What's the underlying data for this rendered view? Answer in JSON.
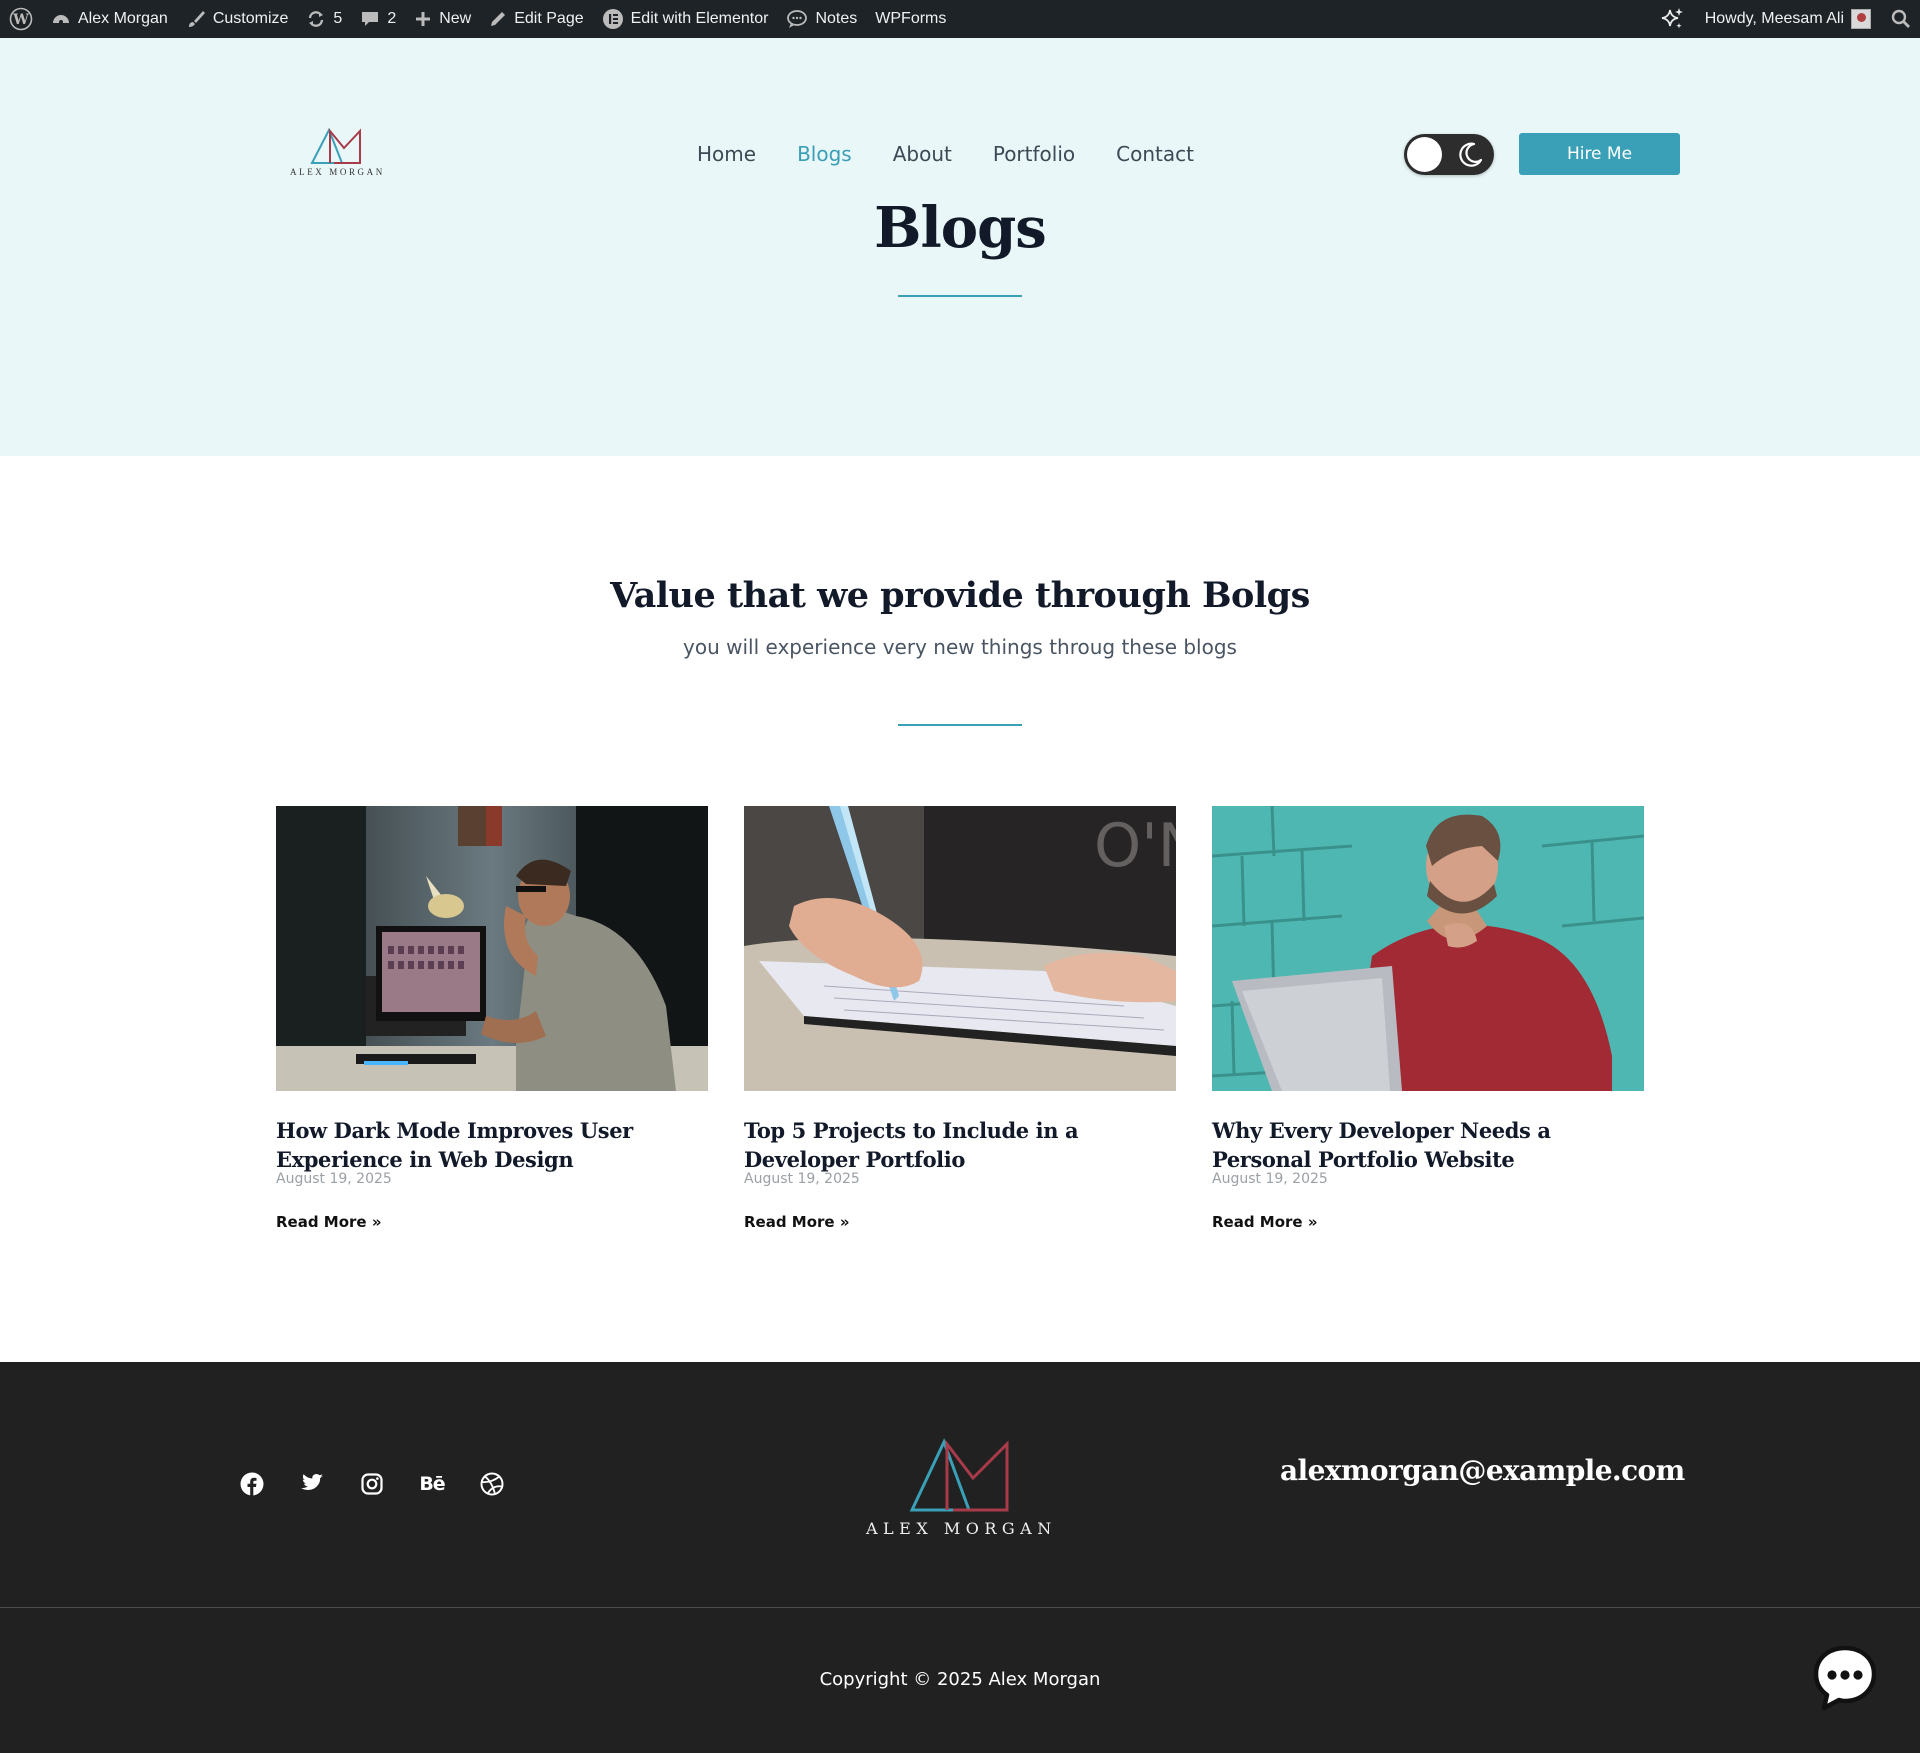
{
  "admin_bar": {
    "site_name": "Alex Morgan",
    "customize": "Customize",
    "updates_count": "5",
    "comments_count": "2",
    "new": "New",
    "edit_page": "Edit Page",
    "edit_elementor": "Edit with Elementor",
    "notes": "Notes",
    "wpforms": "WPForms",
    "howdy": "Howdy, Meesam Ali"
  },
  "header": {
    "logo_text": "ALEX MORGAN",
    "nav": [
      {
        "label": "Home"
      },
      {
        "label": "Blogs"
      },
      {
        "label": "About"
      },
      {
        "label": "Portfolio"
      },
      {
        "label": "Contact"
      }
    ],
    "active_nav": "Blogs",
    "hire_button": "Hire Me",
    "theme_toggle": "light"
  },
  "hero": {
    "title": "Blogs"
  },
  "section": {
    "title": "Value that we provide through Bolgs",
    "subtitle": "you will experience very new things throug these blogs"
  },
  "posts": [
    {
      "title": "How Dark Mode Improves User Experience in Web Design",
      "date": "August 19, 2025",
      "read_more": "Read More »"
    },
    {
      "title": "Top 5 Projects to Include in a Developer Portfolio",
      "date": "August 19, 2025",
      "read_more": "Read More »"
    },
    {
      "title": "Why Every Developer Needs a Personal Portfolio Website",
      "date": "August 19, 2025",
      "read_more": "Read More »"
    }
  ],
  "footer": {
    "social": [
      "facebook-icon",
      "twitter-icon",
      "instagram-icon",
      "behance-icon",
      "dribbble-icon"
    ],
    "behance_glyph": "Bē",
    "logo_text": "ALEX MORGAN",
    "email": "alexmorgan@example.com",
    "copyright": "Copyright © 2025 Alex Morgan"
  },
  "colors": {
    "accent": "#3aa0b8",
    "hero_bg": "#e9f7f8",
    "footer_bg": "#212121",
    "admin_bar": "#1d2327",
    "logo_red": "#a83a4a"
  }
}
